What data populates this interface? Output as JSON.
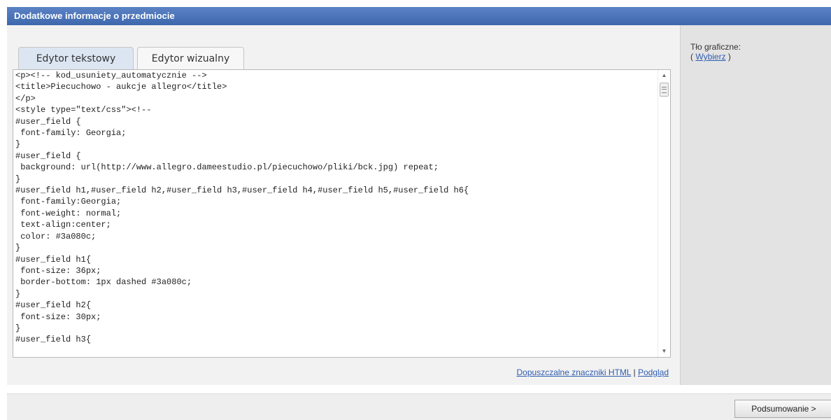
{
  "panel": {
    "title": "Dodatkowe informacje o przedmiocie"
  },
  "tabs": [
    {
      "label": "Edytor tekstowy",
      "active": true
    },
    {
      "label": "Edytor wizualny",
      "active": false
    }
  ],
  "editor": {
    "content": "<p><!-- kod_usuniety_automatycznie -->\n<title>Piecuchowo - aukcje allegro</title>\n</p>\n<style type=\"text/css\"><!--\n#user_field {\n font-family: Georgia;\n}\n#user_field {\n background: url(http://www.allegro.dameestudio.pl/piecuchowo/pliki/bck.jpg) repeat;\n}\n#user_field h1,#user_field h2,#user_field h3,#user_field h4,#user_field h5,#user_field h6{\n font-family:Georgia;\n font-weight: normal;\n text-align:center;\n color: #3a080c;\n}\n#user_field h1{\n font-size: 36px;\n border-bottom: 1px dashed #3a080c;\n}\n#user_field h2{\n font-size: 30px;\n}\n#user_field h3{"
  },
  "links": {
    "allowed_html": "Dopuszczalne znaczniki HTML",
    "separator": "|",
    "preview": "Podgląd"
  },
  "side": {
    "background_label": "Tło graficzne:",
    "open_paren": "(",
    "choose_link": "Wybierz",
    "close_paren": ")"
  },
  "footer": {
    "summary_button": "Podsumowanie >"
  },
  "colors": {
    "header_bar": "#4a72b8",
    "active_tab": "#dce6f2",
    "link": "#2f5db0"
  },
  "icons": {
    "scroll_up": "arrow-up-icon",
    "scroll_down": "arrow-down-icon",
    "scroll_thumb": "scroll-grip-icon"
  }
}
